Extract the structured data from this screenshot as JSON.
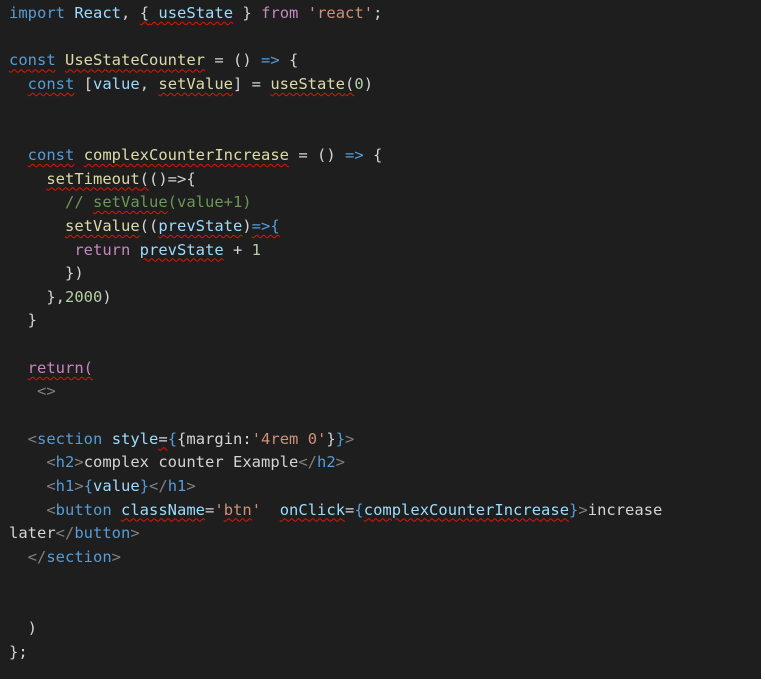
{
  "editor": {
    "lines": [
      [
        [
          "kw",
          "import"
        ],
        [
          "",
          "&nbsp;"
        ],
        [
          "var",
          "React"
        ],
        [
          "",
          ","
        ],
        [
          "",
          "&nbsp;"
        ],
        [
          "sq",
          "{"
        ],
        [
          "var sq",
          "&nbsp;useState"
        ],
        [
          "",
          "&nbsp;}"
        ],
        [
          "",
          "&nbsp;"
        ],
        [
          "ctl",
          "from"
        ],
        [
          "",
          "&nbsp;"
        ],
        [
          "str",
          "'react'"
        ],
        [
          "",
          ";"
        ]
      ],
      [],
      [
        [
          "kw sq",
          "const"
        ],
        [
          "",
          "&nbsp;"
        ],
        [
          "fn sq",
          "UseStateCounter"
        ],
        [
          "",
          "&nbsp;=&nbsp;()&nbsp;"
        ],
        [
          "kw",
          "=>"
        ],
        [
          "",
          "&nbsp;{"
        ]
      ],
      [
        [
          "",
          "&nbsp;&nbsp;"
        ],
        [
          "kw sq",
          "const"
        ],
        [
          "",
          "&nbsp;["
        ],
        [
          "var",
          "value"
        ],
        [
          "",
          ",&nbsp;"
        ],
        [
          "fn sq",
          "setValue"
        ],
        [
          "",
          "]&nbsp;=&nbsp;"
        ],
        [
          "fn sq",
          "useState"
        ],
        [
          "sq",
          "("
        ],
        [
          "num",
          "0"
        ],
        [
          "",
          ")"
        ]
      ],
      [],
      [],
      [
        [
          "",
          "&nbsp;&nbsp;"
        ],
        [
          "kw sq",
          "const"
        ],
        [
          "",
          "&nbsp;"
        ],
        [
          "fn sq",
          "complexCounterIncrease"
        ],
        [
          "",
          "&nbsp;=&nbsp;()&nbsp;"
        ],
        [
          "kw",
          "=>"
        ],
        [
          "",
          "&nbsp;{"
        ]
      ],
      [
        [
          "",
          "&nbsp;&nbsp;&nbsp;&nbsp;"
        ],
        [
          "fn sq",
          "setTimeout"
        ],
        [
          "sq",
          "("
        ],
        [
          "",
          "()=>{"
        ]
      ],
      [
        [
          "",
          "&nbsp;&nbsp;&nbsp;&nbsp;&nbsp;&nbsp;"
        ],
        [
          "cm",
          "//&nbsp;"
        ],
        [
          "cm sq",
          "setValue"
        ],
        [
          "cm",
          "(value+1)"
        ]
      ],
      [
        [
          "",
          "&nbsp;&nbsp;&nbsp;&nbsp;&nbsp;&nbsp;"
        ],
        [
          "fn sq",
          "setValue"
        ],
        [
          "",
          "(("
        ],
        [
          "var sq",
          "prevState"
        ],
        [
          "",
          ")"
        ],
        [
          "kw sq",
          "=>{"
        ]
      ],
      [
        [
          "",
          "&nbsp;&nbsp;&nbsp;&nbsp;&nbsp;&nbsp;&nbsp;"
        ],
        [
          "ctl",
          "return"
        ],
        [
          "",
          "&nbsp;"
        ],
        [
          "var sq",
          "prevState"
        ],
        [
          "",
          "&nbsp;+&nbsp;"
        ],
        [
          "num",
          "1"
        ]
      ],
      [
        [
          "",
          "&nbsp;&nbsp;&nbsp;&nbsp;&nbsp;&nbsp;})"
        ]
      ],
      [
        [
          "",
          "&nbsp;&nbsp;&nbsp;&nbsp;},"
        ],
        [
          "num",
          "2000"
        ],
        [
          "",
          ")"
        ]
      ],
      [
        [
          "",
          "&nbsp;&nbsp;}"
        ]
      ],
      [],
      [
        [
          "",
          "&nbsp;&nbsp;"
        ],
        [
          "ctl sq",
          "return("
        ]
      ],
      [
        [
          "",
          "&nbsp;&nbsp;&nbsp;"
        ],
        [
          "pun",
          "<>"
        ]
      ],
      [],
      [
        [
          "",
          "&nbsp;&nbsp;"
        ],
        [
          "pun",
          "<"
        ],
        [
          "tag",
          "section"
        ],
        [
          "",
          "&nbsp;"
        ],
        [
          "var",
          "style"
        ],
        [
          "sq",
          "="
        ],
        [
          "kw",
          "{"
        ],
        [
          "jsx",
          "{margin:"
        ],
        [
          "str",
          "'4rem&nbsp;0'"
        ],
        [
          "jsx",
          "}"
        ],
        [
          "kw",
          "}"
        ],
        [
          "pun",
          ">"
        ]
      ],
      [
        [
          "",
          "&nbsp;&nbsp;&nbsp;&nbsp;"
        ],
        [
          "pun",
          "<"
        ],
        [
          "tag",
          "h2"
        ],
        [
          "pun",
          ">"
        ],
        [
          "jsx",
          "complex&nbsp;counter&nbsp;Example"
        ],
        [
          "pun",
          "</"
        ],
        [
          "tag",
          "h2"
        ],
        [
          "pun",
          ">"
        ]
      ],
      [
        [
          "",
          "&nbsp;&nbsp;&nbsp;&nbsp;"
        ],
        [
          "pun",
          "<"
        ],
        [
          "tag",
          "h1"
        ],
        [
          "pun",
          ">"
        ],
        [
          "kw",
          "{"
        ],
        [
          "var",
          "value"
        ],
        [
          "kw",
          "}"
        ],
        [
          "pun",
          "</"
        ],
        [
          "tag",
          "h1"
        ],
        [
          "pun",
          ">"
        ]
      ],
      [
        [
          "",
          "&nbsp;&nbsp;&nbsp;&nbsp;"
        ],
        [
          "pun",
          "<"
        ],
        [
          "tag",
          "button"
        ],
        [
          "",
          "&nbsp;"
        ],
        [
          "var sq",
          "className"
        ],
        [
          "",
          "="
        ],
        [
          "str",
          "'"
        ],
        [
          "str sq",
          "btn"
        ],
        [
          "str",
          "'"
        ],
        [
          "",
          "&nbsp;&nbsp;"
        ],
        [
          "var sq",
          "onClick"
        ],
        [
          "",
          "="
        ],
        [
          "kw",
          "{"
        ],
        [
          "var sq",
          "complexCounterIncrease"
        ],
        [
          "kw",
          "}"
        ],
        [
          "pun",
          ">"
        ],
        [
          "jsx",
          "increase"
        ]
      ],
      [
        [
          "jsx",
          "later"
        ],
        [
          "pun",
          "</"
        ],
        [
          "tag",
          "button"
        ],
        [
          "pun",
          ">"
        ]
      ],
      [
        [
          "",
          "&nbsp;&nbsp;"
        ],
        [
          "pun",
          "</"
        ],
        [
          "tag",
          "section"
        ],
        [
          "pun",
          ">"
        ]
      ],
      [],
      [
        [
          "",
          "&nbsp;&nbsp;"
        ],
        [
          "pun",
          "</>"
        ]
      ],
      [
        [
          "",
          "&nbsp;&nbsp;)"
        ]
      ],
      [
        [
          "",
          "};"
        ]
      ]
    ]
  }
}
